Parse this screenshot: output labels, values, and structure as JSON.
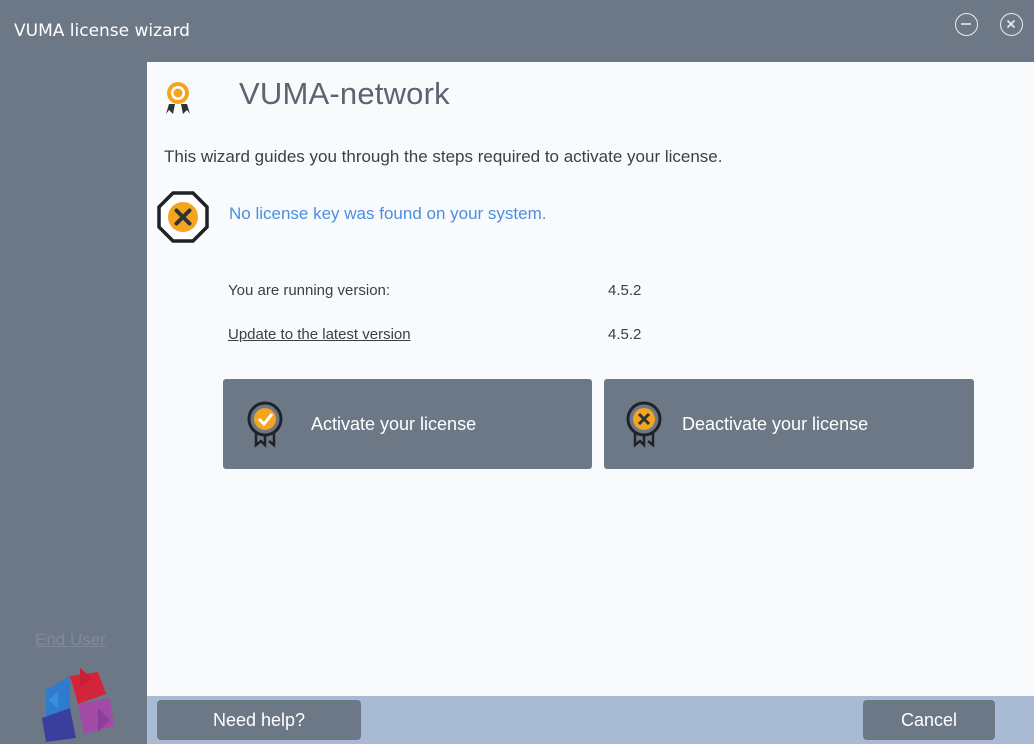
{
  "window": {
    "title": "VUMA license wizard",
    "minimize_icon": "minimize-circle-icon",
    "close_icon": "close-circle-icon"
  },
  "sidebar": {
    "end_user_link": "End User",
    "logo_icon": "vuma-logo-icon"
  },
  "header": {
    "icon": "license-award-icon",
    "app_name": "VUMA-network"
  },
  "intro": {
    "text": "This wizard guides you through the steps required to activate your license."
  },
  "status": {
    "icon": "error-octagon-icon",
    "message": "No license key was found on your system."
  },
  "version_info": {
    "running_label": "You are running version:",
    "running_value": "4.5.2",
    "update_link": "Update to the latest version",
    "latest_value": "4.5.2"
  },
  "actions": {
    "activate_label": "Activate your license",
    "activate_icon": "award-check-icon",
    "deactivate_label": "Deactivate your license",
    "deactivate_icon": "award-x-icon"
  },
  "footer": {
    "help_label": "Need help?",
    "cancel_label": "Cancel"
  },
  "colors": {
    "titlebar": "#6d7887",
    "content_bg": "#f9fafc",
    "accent_orange": "#f3a51f",
    "link_blue": "#4a8fe0",
    "footer_bg": "#a9bbd4"
  }
}
